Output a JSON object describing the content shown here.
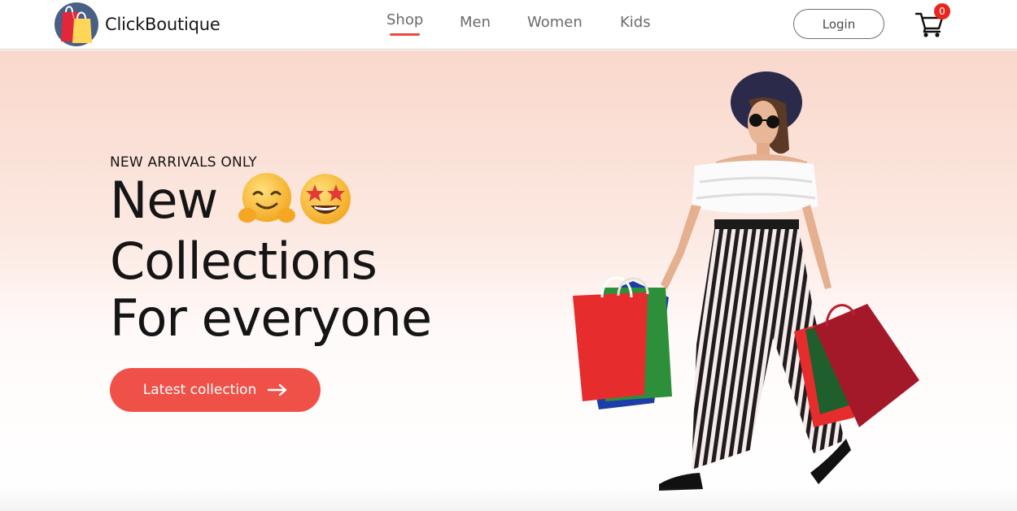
{
  "brand": {
    "name": "ClickBoutique",
    "logo_icon": "shopping-bags-logo-icon"
  },
  "nav": {
    "items": [
      {
        "label": "Shop",
        "active": true
      },
      {
        "label": "Men",
        "active": false
      },
      {
        "label": "Women",
        "active": false
      },
      {
        "label": "Kids",
        "active": false
      }
    ]
  },
  "header": {
    "login_label": "Login",
    "cart_count": "0",
    "cart_icon": "cart-icon"
  },
  "hero": {
    "eyebrow": "NEW ARRIVALS ONLY",
    "headline_line1": "New",
    "headline_line2": "Collections",
    "headline_line3": "For everyone",
    "emojis": [
      "hugging-face-emoji",
      "star-struck-emoji"
    ],
    "cta_label": "Latest collection",
    "cta_icon": "arrow-right-icon",
    "image": "woman-with-shopping-bags-image"
  },
  "colors": {
    "accent": "#ef5148",
    "underline": "#e8483f",
    "badge": "#e8251f",
    "hero_top": "#f9d8cb"
  }
}
